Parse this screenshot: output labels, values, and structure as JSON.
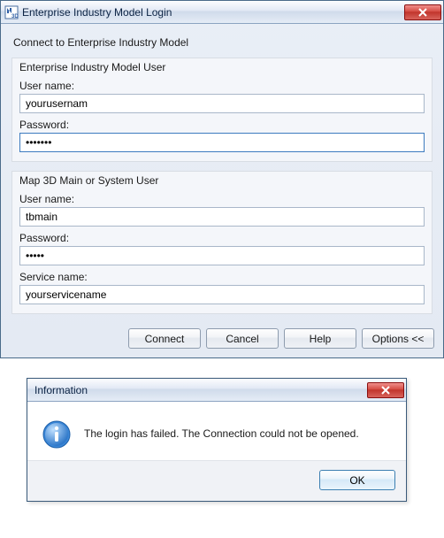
{
  "login": {
    "title": "Enterprise Industry Model Login",
    "subtitle": "Connect to Enterprise Industry Model",
    "group1": {
      "title": "Enterprise Industry Model User",
      "username_label": "User name:",
      "username_value": "yourusernam",
      "password_label": "Password:",
      "password_value": "•••••••"
    },
    "group2": {
      "title": "Map 3D Main or System User",
      "username_label": "User name:",
      "username_value": "tbmain",
      "password_label": "Password:",
      "password_value": "•••••",
      "service_label": "Service name:",
      "service_value": "yourservicename"
    },
    "buttons": {
      "connect": "Connect",
      "cancel": "Cancel",
      "help": "Help",
      "options": "Options <<"
    }
  },
  "info": {
    "title": "Information",
    "message": "The login has failed. The Connection could not be opened.",
    "ok": "OK"
  }
}
